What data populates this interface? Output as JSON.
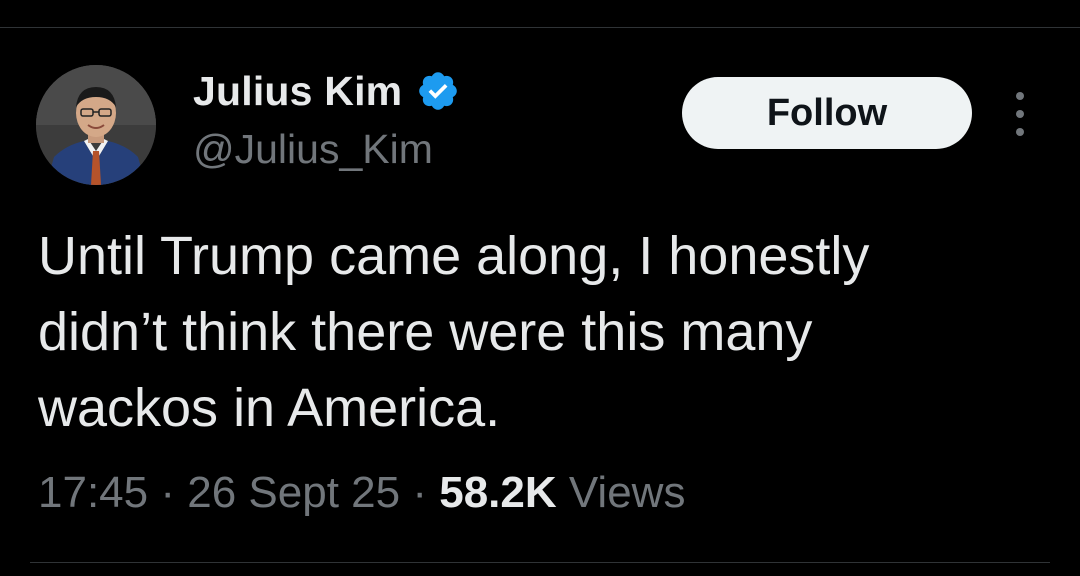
{
  "author": {
    "name": "Julius Kim",
    "handle": "@Julius_Kim",
    "verified_color": "#1d9bf0"
  },
  "actions": {
    "follow_label": "Follow",
    "more_icon": "more-vertical-icon"
  },
  "tweet": {
    "lines": [
      "Until Trump came along, I honestly",
      "didn’t think there were this many",
      "wackos in America."
    ]
  },
  "meta": {
    "time": "17:45",
    "separator": "·",
    "date": "26 Sept 25",
    "views_count": "58.2K",
    "views_label": "Views"
  },
  "colors": {
    "background": "#000000",
    "primary_text": "#e7e9ea",
    "secondary_text": "#71767b",
    "follow_bg": "#eff3f4",
    "divider": "#2f3336"
  }
}
